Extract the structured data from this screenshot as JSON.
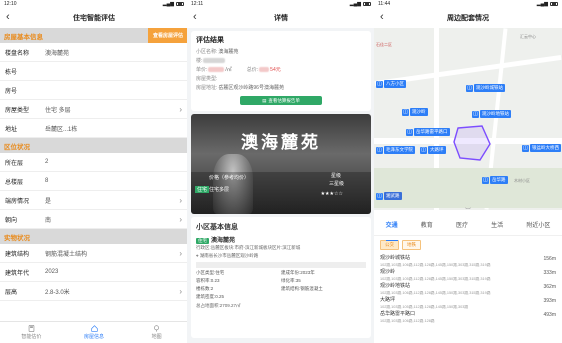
{
  "screen1": {
    "time": "12:10",
    "title": "住宅智能评估",
    "section_house": "房屋基本信息",
    "section_house_btn": "查看房屋评估",
    "rows_house": [
      {
        "label": "楼盘名称",
        "value": "澳海麓苑",
        "chev": false
      },
      {
        "label": "栋号",
        "value": "",
        "chev": false
      },
      {
        "label": "房号",
        "value": "",
        "chev": false
      },
      {
        "label": "房屋类型",
        "value": "住宅  多层",
        "chev": true
      },
      {
        "label": "地址",
        "value": "岳麓区...1栋",
        "chev": false
      }
    ],
    "section_area": "区位状况",
    "rows_area": [
      {
        "label": "所在层",
        "value": "2",
        "chev": false
      },
      {
        "label": "总楼层",
        "value": "8",
        "chev": false
      },
      {
        "label": "端房情况",
        "value": "是",
        "chev": true
      },
      {
        "label": "朝向",
        "value": "南",
        "chev": true
      }
    ],
    "section_phys": "实物状况",
    "rows_phys": [
      {
        "label": "建筑结构",
        "value": "钢筋混凝土结构",
        "chev": true
      },
      {
        "label": "建筑年代",
        "value": "2023",
        "chev": false
      },
      {
        "label": "层高",
        "value": "2.8-3.0米",
        "chev": true
      }
    ],
    "tabs": [
      {
        "label": "智能估价",
        "active": false
      },
      {
        "label": "房屋信息",
        "active": true
      },
      {
        "label": "地图",
        "active": false
      }
    ]
  },
  "screen2": {
    "time": "12:11",
    "title": "详情",
    "result_title": "评估结果",
    "community_label": "小区名称:",
    "community_value": "澳海麓苑",
    "floor_label": "楼:",
    "price_label": "单价:",
    "price_unit": "/㎡",
    "total_label": "总价:",
    "total_unit": "54元",
    "type_label": "房屋类型:",
    "addr_label": "房屋地址:",
    "addr_value": "岳麓区观沙岭路96号澳海麓苑",
    "detail_btn": "查看估算报告单",
    "hero_name": "澳海麓苑",
    "hero_price_label": "价格（参考均价）",
    "hero_tag": "住宅多层",
    "hero_ticket": "住宅",
    "hero_star_label": "星级",
    "hero_star_level": "三星级",
    "hero_stars": "★★★☆☆",
    "info_title": "小区基本信息",
    "info_tag": "住宅",
    "info_name": "澳海麓苑",
    "info_line1": "行政区:岳麓区板块:市府-滨江新城板块区片:滨江新城",
    "info_line2": "湖南省长沙市岳麓区观沙岭路",
    "info_grid": [
      "小区类型:住宅",
      "建成年份:2023年",
      "容积率:0.23",
      "绿化率:35",
      "楼栋数:2",
      "建筑结构:钢筋混凝土",
      "建筑密度:0.25",
      ""
    ],
    "info_area": "总占地面积:2709.27㎡"
  },
  "screen3": {
    "time": "11:44",
    "title": "周边配套情况",
    "map_pois": [
      {
        "label": "八方小区"
      },
      {
        "label": "观沙岭城铁站"
      },
      {
        "label": "观沙岭地铁站"
      },
      {
        "label": "观沙岭"
      },
      {
        "label": "大路坪"
      },
      {
        "label": "岳华路雷平路口"
      },
      {
        "label": "毛泽东文学院"
      },
      {
        "label": "岳华路"
      },
      {
        "label": "银盆岭大桥西"
      },
      {
        "label": "湘武路"
      }
    ],
    "map_labels": [
      "汇云中心",
      "石佳二区",
      "木材小区"
    ],
    "tabs": [
      {
        "label": "交通",
        "active": true
      },
      {
        "label": "教育",
        "active": false
      },
      {
        "label": "医疗",
        "active": false
      },
      {
        "label": "生活",
        "active": false
      },
      {
        "label": "附近小区",
        "active": false
      }
    ],
    "chips": [
      {
        "label": "公交",
        "active": true
      },
      {
        "label": "地铁",
        "active": false
      }
    ],
    "stops": [
      {
        "name": "观沙岭城铁站",
        "routes": "102路,103路,106路,112路,128路,145路,150路,303路,315路,319路",
        "dist": "156m"
      },
      {
        "name": "观沙岭",
        "routes": "102路,103路,105路,112路,128路,145路,150路,303路,315路,319路",
        "dist": "333m"
      },
      {
        "name": "观沙岭地铁站",
        "routes": "102路,103路,106路,112路,128路,145路,150路,303路,315路,319路",
        "dist": "362m"
      },
      {
        "name": "大路坪",
        "routes": "102路,103路,105路,112路,128路,145路,150路,303路",
        "dist": "393m"
      },
      {
        "name": "岳华路雷平路口",
        "routes": "102路,103路,106路,112路,128路",
        "dist": "493m"
      }
    ]
  },
  "colors": {
    "accent": "#2d7ef7",
    "orange": "#e98a1a",
    "green": "#2fa866",
    "price_red": "#e04a4a"
  }
}
